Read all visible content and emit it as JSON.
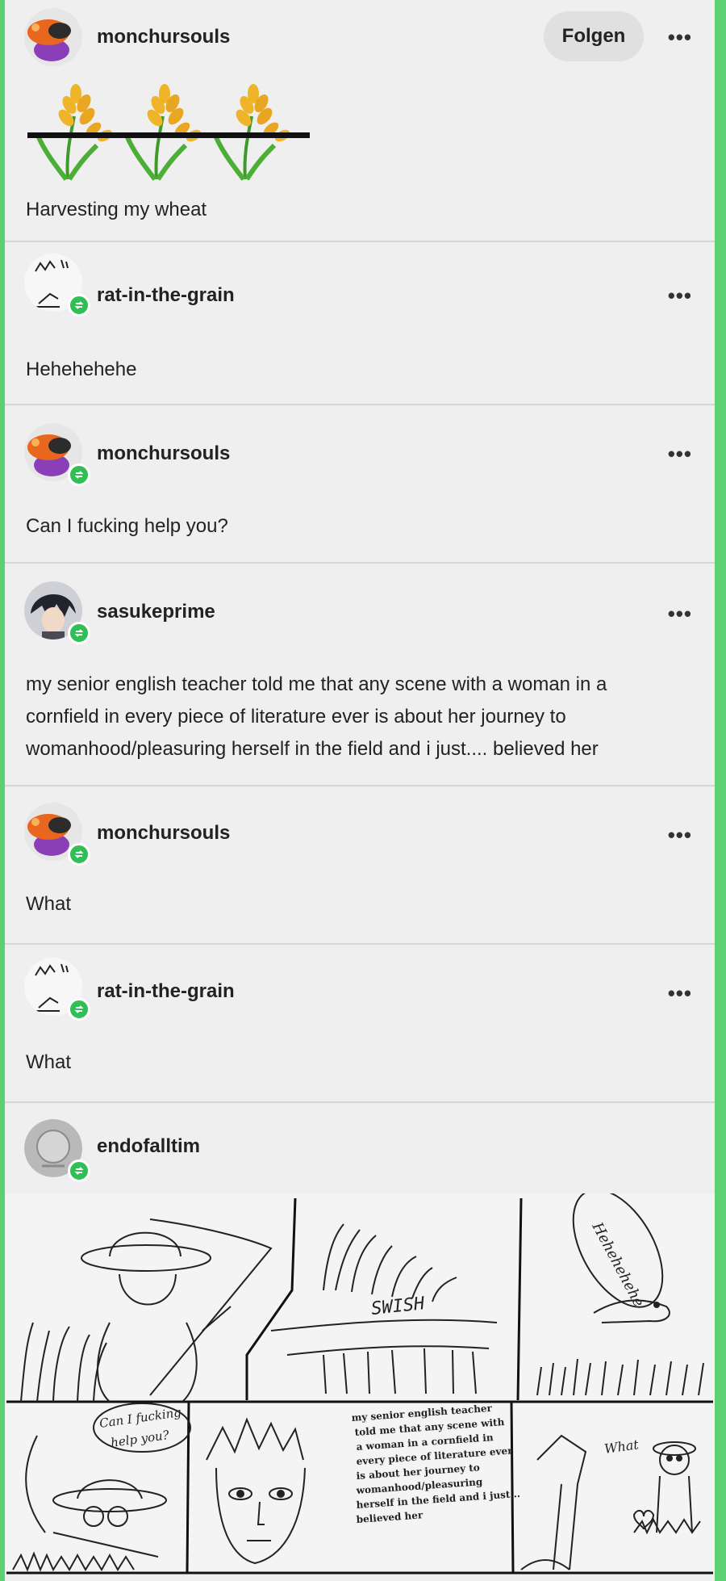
{
  "posts": [
    {
      "username": "monchursouls",
      "follow_label": "Folgen",
      "text": "Harvesting my wheat"
    },
    {
      "username": "rat-in-the-grain",
      "text": "Hehehehehe"
    },
    {
      "username": "monchursouls",
      "text": "Can I fucking help you?"
    },
    {
      "username": "sasukeprime",
      "text_lines": [
        "my senior english teacher told me that any scene with a woman in a",
        "cornfield in every piece of literature ever is about her journey to",
        "womanhood/pleasuring herself in the field and i just.... believed her"
      ]
    },
    {
      "username": "monchursouls",
      "text": "What"
    },
    {
      "username": "rat-in-the-grain",
      "text": "What"
    },
    {
      "username": "endofalltim"
    }
  ],
  "more_label": "•••",
  "comic": {
    "bubble_1": "Hehehehehe",
    "sfx": "SWISH",
    "bubble_2": [
      "Can I fucking",
      "help you?"
    ],
    "panel_text": [
      "my senior english teacher",
      "told me that any scene with",
      "a woman in a cornfield in",
      "every piece of literature ever",
      "is about her journey to",
      "womanhood/pleasuring",
      "herself in the field and i just...",
      "believed her"
    ],
    "bubble_3": "What"
  },
  "colors": {
    "accent_green": "#2fbf55",
    "frame_green": "#5fcf74"
  }
}
